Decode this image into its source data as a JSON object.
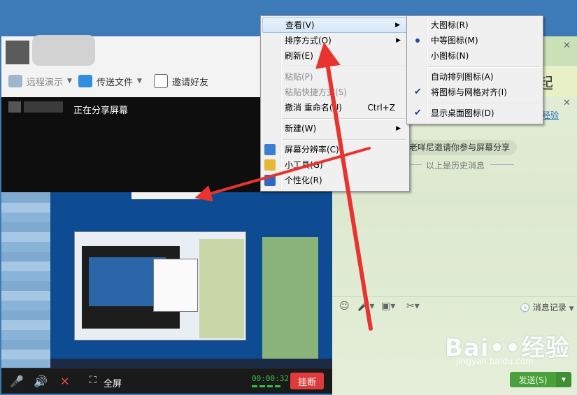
{
  "toolbar": {
    "remote_demo": "远程演示",
    "send_file": "传送文件",
    "invite_friends": "邀请好友"
  },
  "share": {
    "status": "正在分享屏幕"
  },
  "controls": {
    "fullscreen": "全屏",
    "timer": "00:00:32",
    "hangup": "挂断"
  },
  "chat": {
    "banner": "元起",
    "link": "经验",
    "invite_message": "老咩尼邀请你参与屏幕分享",
    "history": "以上是历史消息",
    "message_record": "消息记录",
    "send": "发送(S)"
  },
  "context_menu": {
    "items": [
      {
        "label": "查看(V)"
      },
      {
        "label": "排序方式(O)"
      },
      {
        "label": "刷新(E)"
      },
      {
        "label": "粘贴(P)"
      },
      {
        "label": "粘贴快捷方式(S)"
      },
      {
        "label": "撤消 重命名(U)",
        "shortcut": "Ctrl+Z"
      },
      {
        "label": "新建(W)"
      },
      {
        "label": "屏幕分辨率(C)"
      },
      {
        "label": "小工具(G)"
      },
      {
        "label": "个性化(R)"
      }
    ]
  },
  "submenu": {
    "items": [
      {
        "label": "大图标(R)"
      },
      {
        "label": "中等图标(M)"
      },
      {
        "label": "小图标(N)"
      },
      {
        "label": "自动排列图标(A)"
      },
      {
        "label": "将图标与网格对齐(I)"
      },
      {
        "label": "显示桌面图标(D)"
      }
    ]
  },
  "watermark": {
    "brand": "Bai••经验",
    "url": "jingyan.baidu.com"
  },
  "colors": {
    "accent_red": "#e8332f",
    "hangup_red": "#e03b3b",
    "send_green": "#4aa03c"
  }
}
